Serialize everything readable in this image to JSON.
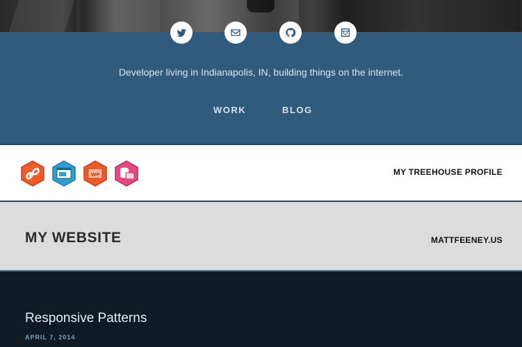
{
  "social": [
    {
      "name": "twitter-icon"
    },
    {
      "name": "mail-icon"
    },
    {
      "name": "github-icon"
    },
    {
      "name": "instagram-icon"
    }
  ],
  "intro": {
    "tagline": "Developer living in Indianapolis, IN, building things on the internet."
  },
  "nav": {
    "work": "WORK",
    "blog": "BLOG"
  },
  "treehouse": {
    "badges": [
      "link-badge-icon",
      "browser-badge-icon",
      "wordpress-badge-icon",
      "database-badge-icon"
    ],
    "link_label": "MY TREEHOUSE PROFILE"
  },
  "website": {
    "title": "MY WEBSITE",
    "link_label": "MATTFEENEY.US"
  },
  "post": {
    "title": "Responsive Patterns",
    "date": "APRIL 7, 2014"
  },
  "colors": {
    "intro_bg": "#305b7c",
    "badge_orange": "#f05a28",
    "badge_blue": "#2f9fd1",
    "badge_pink": "#e7487f"
  }
}
